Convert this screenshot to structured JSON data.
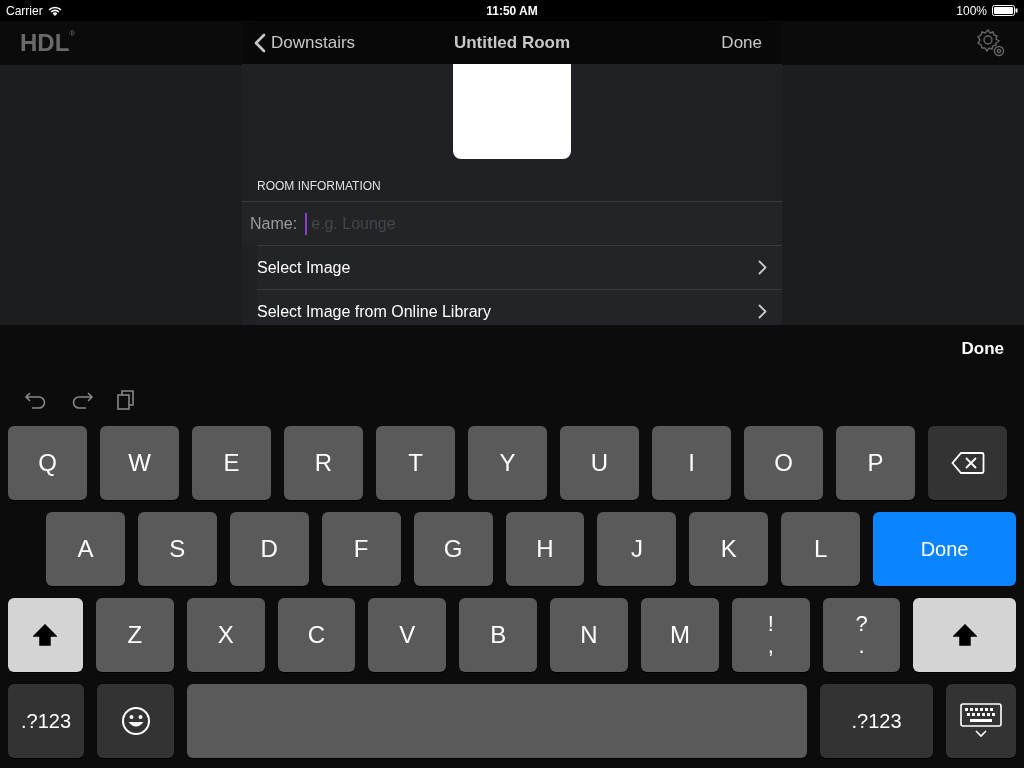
{
  "status_bar": {
    "carrier": "Carrier",
    "time": "11:50 AM",
    "battery": "100%"
  },
  "app_bar": {
    "logo": "HDL",
    "logo_mark": "®"
  },
  "modal": {
    "back": "Downstairs",
    "title": "Untitled Room",
    "done": "Done",
    "section": "ROOM INFORMATION",
    "name_field": {
      "label": "Name:",
      "placeholder": "e.g. Lounge"
    },
    "rows": [
      {
        "label": "Select Image"
      },
      {
        "label": "Select Image from Online Library"
      }
    ]
  },
  "keyboard": {
    "done": "Done",
    "rows": [
      {
        "keys": [
          {
            "kind": "letter",
            "label": "Q"
          },
          {
            "kind": "letter",
            "label": "W"
          },
          {
            "kind": "letter",
            "label": "E"
          },
          {
            "kind": "letter",
            "label": "R"
          },
          {
            "kind": "letter",
            "label": "T"
          },
          {
            "kind": "letter",
            "label": "Y"
          },
          {
            "kind": "letter",
            "label": "U"
          },
          {
            "kind": "letter",
            "label": "I"
          },
          {
            "kind": "letter",
            "label": "O"
          },
          {
            "kind": "letter",
            "label": "P"
          },
          {
            "kind": "backspace"
          }
        ]
      },
      {
        "keys": [
          {
            "kind": "letter",
            "label": "A"
          },
          {
            "kind": "letter",
            "label": "S"
          },
          {
            "kind": "letter",
            "label": "D"
          },
          {
            "kind": "letter",
            "label": "F"
          },
          {
            "kind": "letter",
            "label": "G"
          },
          {
            "kind": "letter",
            "label": "H"
          },
          {
            "kind": "letter",
            "label": "J"
          },
          {
            "kind": "letter",
            "label": "K"
          },
          {
            "kind": "letter",
            "label": "L"
          },
          {
            "kind": "return",
            "label": "Done"
          }
        ]
      },
      {
        "keys": [
          {
            "kind": "shift",
            "on": true
          },
          {
            "kind": "letter",
            "label": "Z"
          },
          {
            "kind": "letter",
            "label": "X"
          },
          {
            "kind": "letter",
            "label": "C"
          },
          {
            "kind": "letter",
            "label": "V"
          },
          {
            "kind": "letter",
            "label": "B"
          },
          {
            "kind": "letter",
            "label": "N"
          },
          {
            "kind": "letter",
            "label": "M"
          },
          {
            "kind": "punct",
            "top": "!",
            "bottom": ","
          },
          {
            "kind": "punct",
            "top": "?",
            "bottom": "."
          },
          {
            "kind": "shift",
            "on": true
          }
        ]
      },
      {
        "keys": [
          {
            "kind": "mode",
            "label": ".?123"
          },
          {
            "kind": "emoji"
          },
          {
            "kind": "space"
          },
          {
            "kind": "mode",
            "label": ".?123"
          },
          {
            "kind": "hide"
          }
        ]
      }
    ]
  }
}
